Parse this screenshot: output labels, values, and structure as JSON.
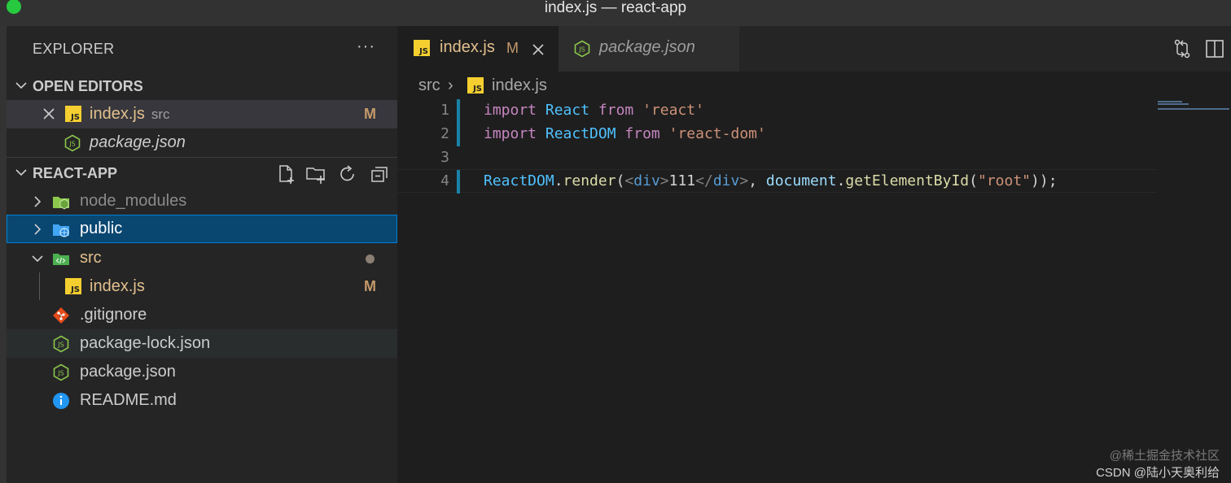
{
  "window": {
    "title": "index.js — react-app"
  },
  "explorer": {
    "title": "EXPLORER",
    "more_label": "···",
    "open_editors": {
      "label": "OPEN EDITORS",
      "items": [
        {
          "name": "index.js",
          "desc": "src",
          "badge": "M"
        },
        {
          "name": "package.json"
        }
      ]
    },
    "project": {
      "label": "REACT-APP",
      "items": [
        {
          "name": "node_modules"
        },
        {
          "name": "public"
        },
        {
          "name": "src"
        },
        {
          "name": "index.js",
          "badge": "M"
        },
        {
          "name": ".gitignore"
        },
        {
          "name": "package-lock.json"
        },
        {
          "name": "package.json"
        },
        {
          "name": "README.md"
        }
      ]
    }
  },
  "tabs": [
    {
      "label": "index.js",
      "badge": "M",
      "close": "✕"
    },
    {
      "label": "package.json"
    }
  ],
  "breadcrumb": {
    "folder": "src",
    "separator": "›",
    "file": "index.js"
  },
  "code": {
    "line_numbers": [
      "1",
      "2",
      "3",
      "4"
    ]
  },
  "watermark": {
    "line1": "@稀土掘金技术社区",
    "line2": "CSDN @陆小天奥利给"
  },
  "colors": {
    "accent": "#007fd4",
    "selection": "#094771",
    "modified": "#c49a6a",
    "js_icon": "#f5cf2f",
    "node_icon": "#8cc84b"
  }
}
